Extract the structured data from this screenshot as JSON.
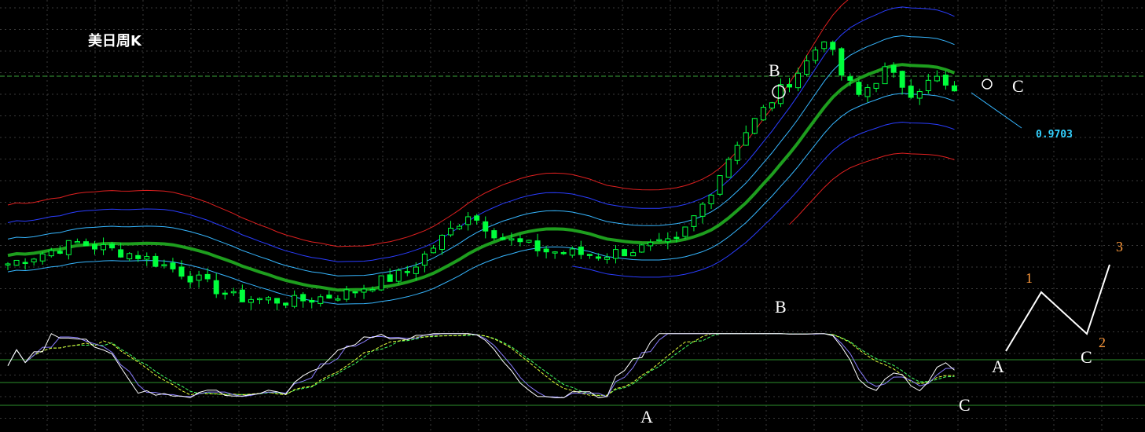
{
  "title": "美日周K",
  "price_label": "0.9703",
  "main_labels": {
    "b_top": "B",
    "c_right": "C",
    "b_bottom": "B"
  },
  "osc_labels": {
    "a": "A",
    "c": "C"
  },
  "wave_labels": {
    "start": "A",
    "p1": "1",
    "p2": "2",
    "p3": "3",
    "c": "C"
  },
  "colors": {
    "background": "#000000",
    "grid": "#3a3a3a",
    "candle": "#00ff3c",
    "mid_band": "#1e9e1e",
    "inner_band": "#36b6ff",
    "middle_band": "#2a3dff",
    "outer_band": "#e02020",
    "hline": "#3aa33a",
    "osc_levels": "#2d8f2d",
    "osc_k": "#ffffff",
    "osc_d": "#8a7dff",
    "osc_slow": "#e8ff3c",
    "osc_slow2": "#42ff62",
    "wave": "#ffffff",
    "wave_number": "#ff9a3c",
    "price_label": "#33d1ff"
  },
  "chart_data": {
    "type": "candlestick",
    "title": "美日周K",
    "indicator": "bands around moving average with stochastic-style oscillator",
    "bars": 110,
    "horizontal_level": 0.9703,
    "grid": true,
    "annotations": [
      "B",
      "C",
      "B",
      "A",
      "C",
      "1",
      "2",
      "3",
      "A",
      "C"
    ],
    "close_path": [
      [
        0,
        0.58
      ],
      [
        8,
        0.63
      ],
      [
        15,
        0.6
      ],
      [
        20,
        0.56
      ],
      [
        26,
        0.5
      ],
      [
        33,
        0.49
      ],
      [
        39,
        0.51
      ],
      [
        46,
        0.56
      ],
      [
        53,
        0.7
      ],
      [
        57,
        0.64
      ],
      [
        62,
        0.61
      ],
      [
        68,
        0.6
      ],
      [
        74,
        0.62
      ],
      [
        77,
        0.63
      ],
      [
        80,
        0.72
      ],
      [
        84,
        0.87
      ],
      [
        88,
        0.97
      ],
      [
        92,
        1.06
      ],
      [
        94,
        1.12
      ],
      [
        96,
        1.03
      ],
      [
        98,
        0.98
      ],
      [
        101,
        1.04
      ],
      [
        104,
        0.99
      ],
      [
        107,
        1.02
      ],
      [
        109,
        0.98
      ]
    ]
  }
}
